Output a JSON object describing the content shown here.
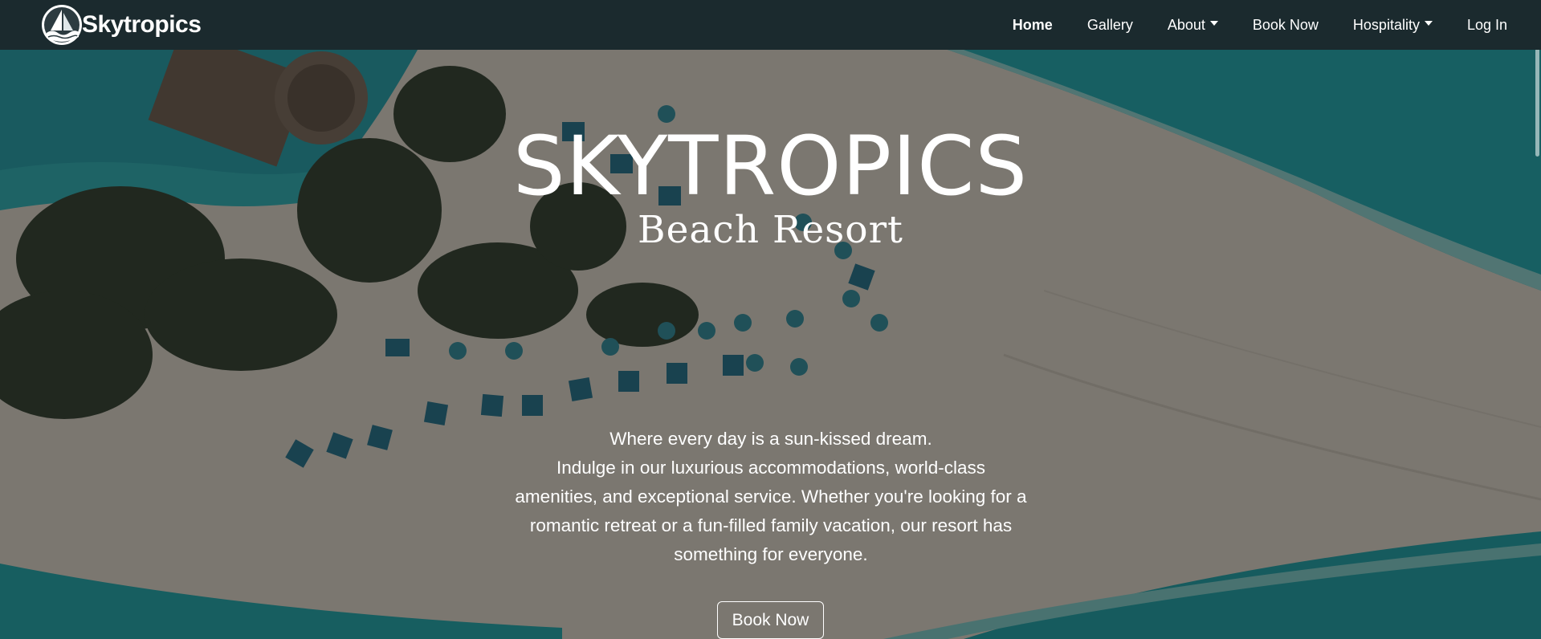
{
  "brand": {
    "name": "Skytropics",
    "logo_icon": "sailboat-wave-logo"
  },
  "nav": {
    "items": [
      {
        "label": "Home",
        "active": true,
        "dropdown": false
      },
      {
        "label": "Gallery",
        "active": false,
        "dropdown": false
      },
      {
        "label": "About",
        "active": false,
        "dropdown": true
      },
      {
        "label": "Book Now",
        "active": false,
        "dropdown": false
      },
      {
        "label": "Hospitality",
        "active": false,
        "dropdown": true
      },
      {
        "label": "Log In",
        "active": false,
        "dropdown": false
      }
    ]
  },
  "hero": {
    "title": "SKYTROPICS",
    "subtitle": "Beach Resort",
    "tagline": "Where every day is a sun-kissed dream.",
    "description": "Indulge in our luxurious accommodations, world-class amenities, and exceptional service. Whether you're looking for a romantic retreat or a fun-filled family vacation, our resort has something for everyone.",
    "cta_label": "Book Now"
  },
  "colors": {
    "navbar_bg": "#1b2a2e",
    "ocean": "#19a3a6",
    "sand": "#e3d9cb",
    "text": "#ffffff"
  }
}
